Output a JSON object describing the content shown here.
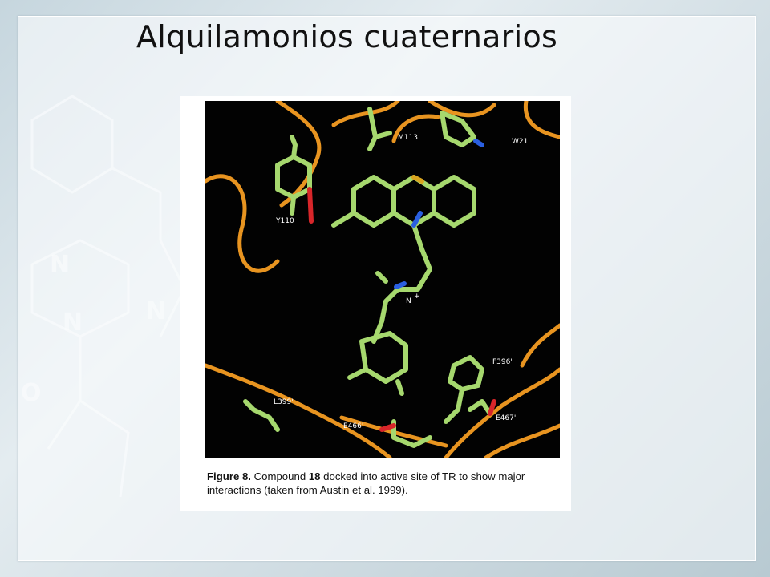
{
  "slide": {
    "title": "Alquilamonios cuaternarios"
  },
  "figure": {
    "caption_label": "Figure 8.",
    "caption_text_1": " Compound ",
    "caption_compound": "18",
    "caption_text_2": " docked into active site of TR to show major interactions (taken from Austin et al. 1999).",
    "residue_labels": {
      "m113": "M113",
      "w21": "W21",
      "y110": "Y110",
      "n_plus": "N",
      "n_plus_sup": "+",
      "f396": "F396'",
      "l399": "L399'",
      "e466": "E466'",
      "e467": "E467'"
    }
  },
  "colors": {
    "ribbon": "#e89420",
    "carbon": "#a6d86e",
    "nitrogen": "#2a5fe0",
    "oxygen": "#d8262a",
    "sulfur": "#d9a520"
  }
}
